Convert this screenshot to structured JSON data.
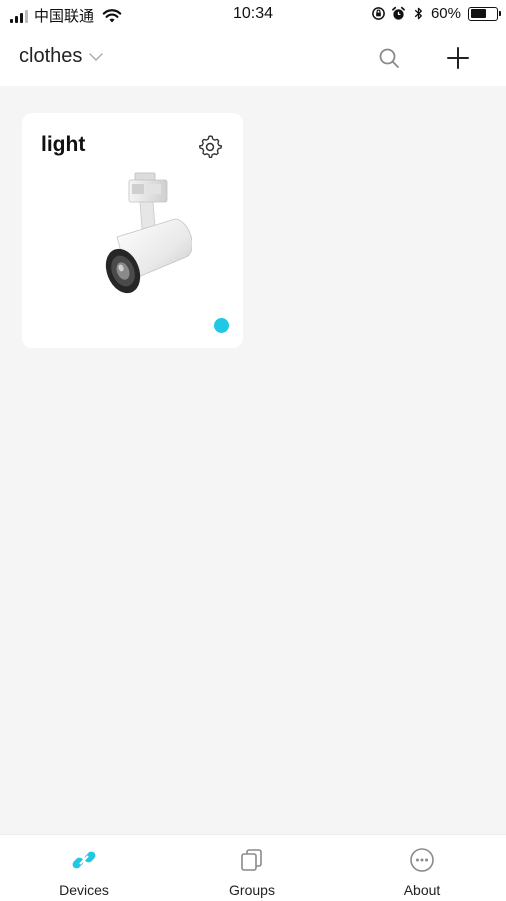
{
  "status_bar": {
    "carrier": "中国联通",
    "time": "10:34",
    "battery_percent": "60%",
    "battery_level": 0.6,
    "icons": [
      "signal-icon",
      "wifi-icon",
      "orientation-lock-icon",
      "alarm-icon",
      "bluetooth-icon",
      "battery-icon"
    ]
  },
  "header": {
    "home_name": "clothes",
    "icons": [
      "chevron-down-icon",
      "search-icon",
      "plus-icon"
    ]
  },
  "devices": [
    {
      "name": "light",
      "image": "track-spotlight",
      "online": true,
      "icons": [
        "settings-gear-icon"
      ]
    }
  ],
  "tabs": [
    {
      "label": "Devices",
      "icon": "link-icon",
      "active": true
    },
    {
      "label": "Groups",
      "icon": "groups-icon",
      "active": false
    },
    {
      "label": "About",
      "icon": "more-icon",
      "active": false
    }
  ],
  "colors": {
    "accent": "#1fc8e3",
    "background": "#f5f5f5",
    "card": "#ffffff",
    "text": "#222222",
    "icon_gray": "#8a8a8a"
  }
}
